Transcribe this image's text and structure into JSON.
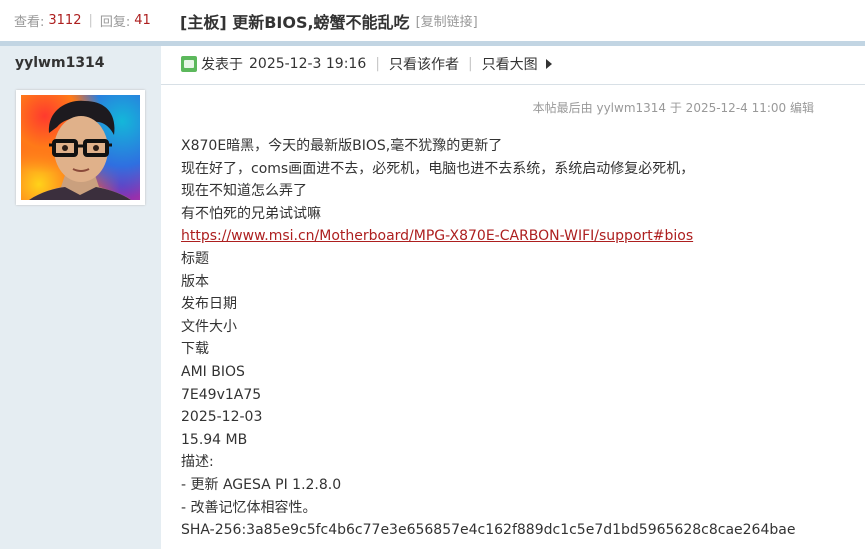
{
  "stats": {
    "views_label": "查看:",
    "views": "3112",
    "replies_label": "回复:",
    "replies": "41"
  },
  "thread": {
    "title": "[主板] 更新BIOS,螃蟹不能乱吃",
    "copy_link": "[复制链接]"
  },
  "author": {
    "username": "yylwm1314"
  },
  "post": {
    "posted_label": "发表于",
    "posted_time": "2025-12-3 19:16",
    "only_author": "只看该作者",
    "only_large_images": "只看大图",
    "edit_note": "本帖最后由 yylwm1314 于 2025-12-4 11:00 编辑",
    "lines": [
      "X870E暗黑，今天的最新版BIOS,毫不犹豫的更新了",
      "现在好了，coms画面进不去，必死机，电脑也进不去系统，系统启动修复必死机，",
      "现在不知道怎么弄了",
      "有不怕死的兄弟试试嘛"
    ],
    "link": "https://www.msi.cn/Motherboard/MPG-X870E-CARBON-WIFI/support#bios",
    "details": [
      "标题",
      "版本",
      "发布日期",
      "文件大小",
      "下载",
      "AMI BIOS",
      "7E49v1A75",
      "2025-12-03",
      "15.94 MB",
      "描述:",
      "- 更新 AGESA PI 1.2.8.0",
      "- 改善记忆体相容性。",
      "SHA-256:3a85e9c5fc4b6c77e3e656857e4c162f889dc1c5e7d1bd5965628c8cae264bae"
    ]
  },
  "icons": {
    "online": "user-online-icon",
    "arrow": "triangle-right-icon"
  }
}
